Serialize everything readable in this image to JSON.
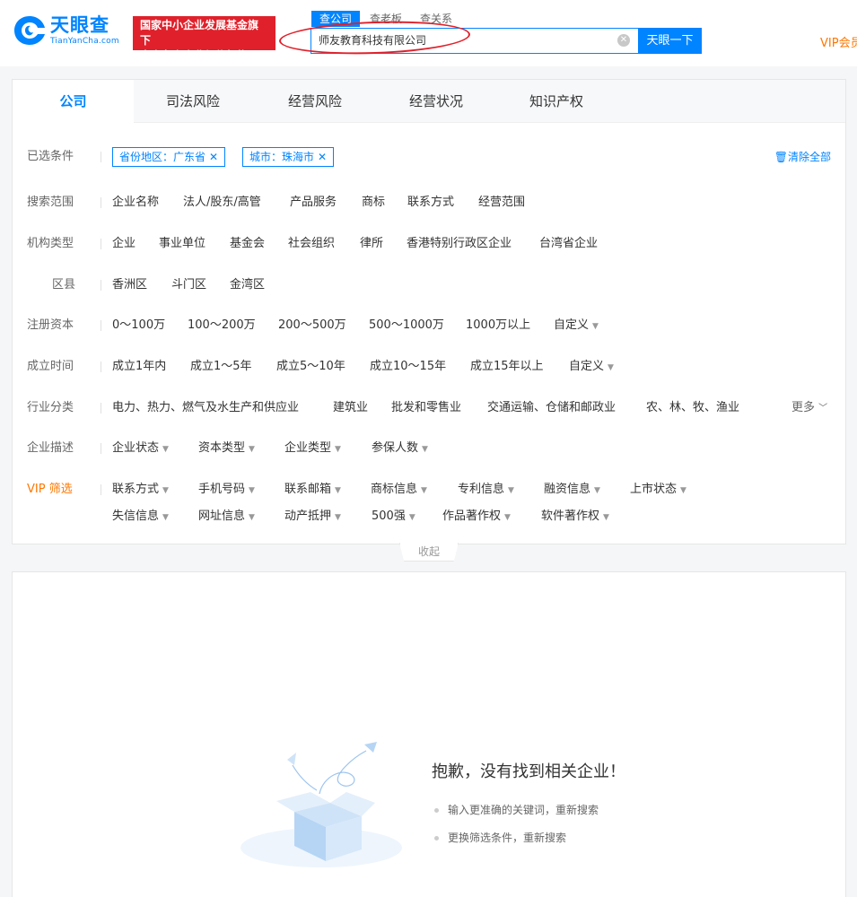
{
  "header": {
    "logo": {
      "text": "天眼查",
      "sub": "TianYanCha.com"
    },
    "promo": {
      "line1": "国家中小企业发展基金旗下",
      "line2": "官方备案企业征信机构"
    },
    "search_tabs": [
      "查公司",
      "查老板",
      "查关系"
    ],
    "search_value": "师友教育科技有限公司",
    "search_button": "天眼一下",
    "vip_link": "VIP会员"
  },
  "tabs": [
    "公司",
    "司法风险",
    "经营风险",
    "经营状况",
    "知识产权"
  ],
  "filters": {
    "selected_label": "已选条件",
    "chips": [
      "省份地区：广东省",
      "城市：珠海市"
    ],
    "clear_all": "清除全部",
    "scope_label": "搜索范围",
    "scope": [
      "企业名称",
      "法人/股东/高管",
      "产品服务",
      "商标",
      "联系方式",
      "经营范围"
    ],
    "org_label": "机构类型",
    "org": [
      "企业",
      "事业单位",
      "基金会",
      "社会组织",
      "律所",
      "香港特别行政区企业",
      "台湾省企业"
    ],
    "district_label": "区县",
    "district": [
      "香洲区",
      "斗门区",
      "金湾区"
    ],
    "capital_label": "注册资本",
    "capital": [
      "0～100万",
      "100～200万",
      "200～500万",
      "500～1000万",
      "1000万以上",
      "自定义"
    ],
    "founded_label": "成立时间",
    "founded": [
      "成立1年内",
      "成立1～5年",
      "成立5～10年",
      "成立10～15年",
      "成立15年以上",
      "自定义"
    ],
    "industry_label": "行业分类",
    "industry": [
      "电力、热力、燃气及水生产和供应业",
      "建筑业",
      "批发和零售业",
      "交通运输、仓储和邮政业",
      "农、林、牧、渔业"
    ],
    "more": "更多",
    "desc_label": "企业描述",
    "desc": [
      "企业状态",
      "资本类型",
      "企业类型",
      "参保人数"
    ],
    "vip_label": "VIP 筛选",
    "vip_row1": [
      "联系方式",
      "手机号码",
      "联系邮箱",
      "商标信息",
      "专利信息",
      "融资信息",
      "上市状态"
    ],
    "vip_row2": [
      "失信信息",
      "网址信息",
      "动产抵押",
      "500强",
      "作品著作权",
      "软件著作权"
    ],
    "collapse": "收起"
  },
  "result": {
    "title": "抱歉，没有找到相关企业！",
    "tips": [
      "输入更准确的关键词，重新搜索",
      "更换筛选条件，重新搜索"
    ]
  },
  "colors": {
    "brand": "#0084ff",
    "promo": "#e0212b",
    "vip": "#ff7700",
    "annotation": "#e0212b"
  }
}
